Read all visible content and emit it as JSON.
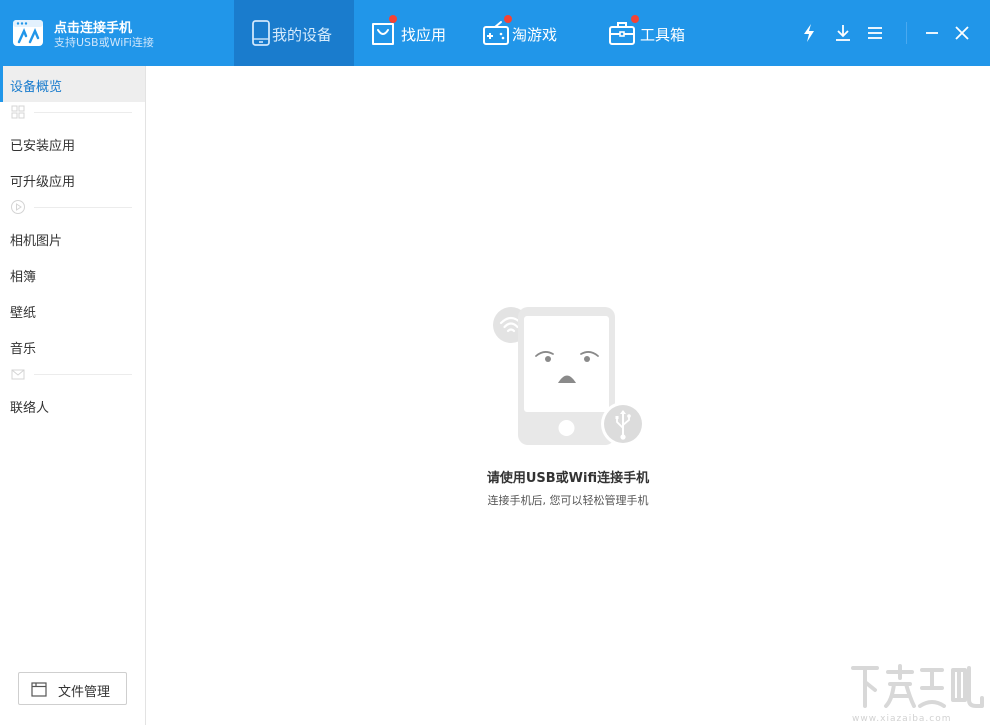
{
  "header": {
    "brand_title": "点击连接手机",
    "brand_subtitle": "支持USB或WiFi连接",
    "brand_color": "#2196e9",
    "tabs": [
      {
        "label": "我的设备",
        "icon": "phone-icon",
        "active": true,
        "badge": false
      },
      {
        "label": "找应用",
        "icon": "shopping-bag-icon",
        "active": false,
        "badge": true
      },
      {
        "label": "淘游戏",
        "icon": "gamepad-icon",
        "active": false,
        "badge": true
      },
      {
        "label": "工具箱",
        "icon": "toolbox-icon",
        "active": false,
        "badge": true
      }
    ],
    "actions": [
      "lightning-icon",
      "download-icon",
      "menu-icon",
      "minimize-icon",
      "close-icon"
    ],
    "badge_color": "#f44336"
  },
  "sidebar": {
    "items": [
      {
        "label": "设备概览",
        "active": true
      },
      {
        "label": "已安装应用"
      },
      {
        "label": "可升级应用"
      },
      {
        "label": "相机图片"
      },
      {
        "label": "相簿"
      },
      {
        "label": "壁纸"
      },
      {
        "label": "音乐"
      },
      {
        "label": "联络人"
      }
    ],
    "separators": [
      "apps-grid-icon",
      "play-circle-icon",
      "mail-icon"
    ],
    "file_manager_label": "文件管理",
    "file_manager_icon": "folder-icon"
  },
  "main": {
    "empty_title": "请使用USB或Wifi连接手机",
    "empty_subtitle": "连接手机后, 您可以轻松管理手机",
    "illustration": "disconnected-phone-icon",
    "accent_gray": "#e6e6e6"
  }
}
